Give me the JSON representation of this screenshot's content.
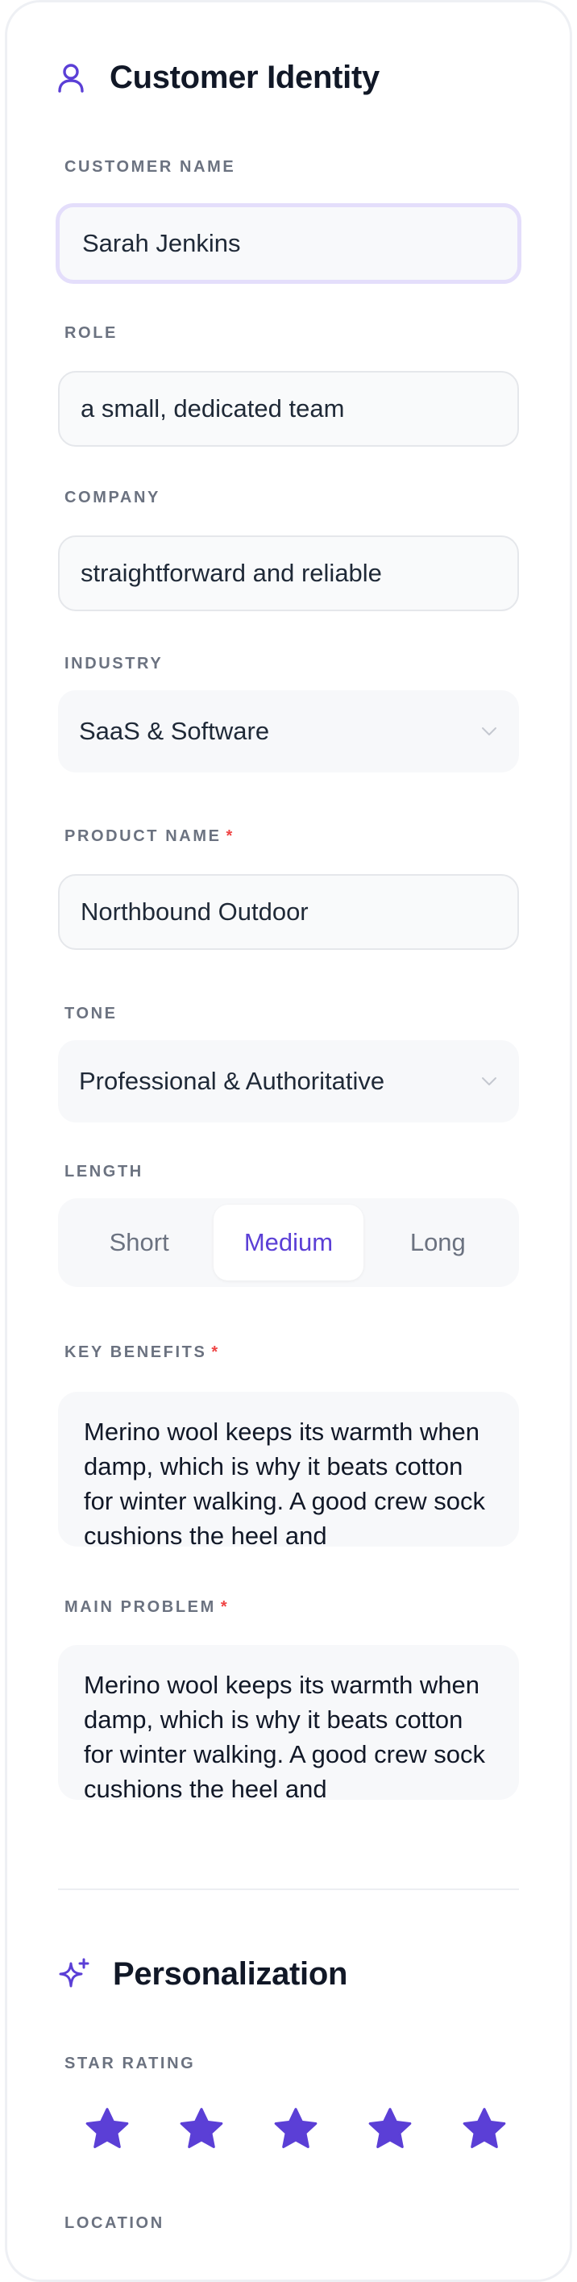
{
  "identity": {
    "title": "Customer Identity",
    "icon": "user-icon",
    "customer_name": {
      "label": "CUSTOMER NAME",
      "value": "Sarah Jenkins"
    },
    "role": {
      "label": "ROLE",
      "value": "a small, dedicated team"
    },
    "company": {
      "label": "COMPANY",
      "value": "straightforward and reliable"
    },
    "industry": {
      "label": "INDUSTRY",
      "value": "SaaS & Software"
    },
    "product_name": {
      "label": "PRODUCT NAME",
      "required_mark": "*",
      "value": "Northbound Outdoor"
    },
    "tone": {
      "label": "TONE",
      "value": "Professional & Authoritative"
    },
    "length": {
      "label": "LENGTH",
      "options": [
        "Short",
        "Medium",
        "Long"
      ],
      "selected": "Medium"
    },
    "key_benefits": {
      "label": "KEY BENEFITS",
      "required_mark": "*",
      "value": "Merino wool keeps its warmth when damp, which is why it beats cotton for winter walking. A good crew sock cushions the heel and"
    },
    "main_problem": {
      "label": "MAIN PROBLEM",
      "required_mark": "*",
      "value": "Merino wool keeps its warmth when damp, which is why it beats cotton for winter walking. A good crew sock cushions the heel and"
    }
  },
  "personalization": {
    "title": "Personalization",
    "icon": "sparkles-icon",
    "star_rating": {
      "label": "STAR RATING",
      "value": 5,
      "max": 5
    },
    "location": {
      "label": "LOCATION"
    }
  },
  "colors": {
    "accent": "#5b3fd6",
    "required": "#ef4444",
    "label": "#6b7280",
    "field_bg": "#f9fafb",
    "focus_ring": "#e4defb"
  }
}
